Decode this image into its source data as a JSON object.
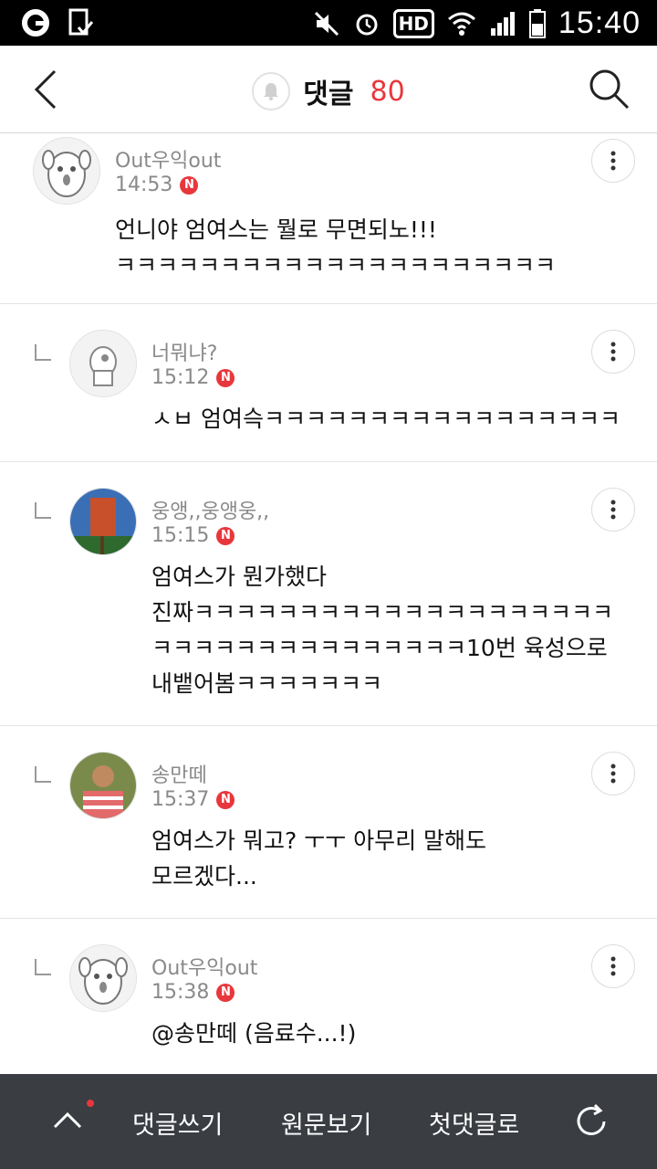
{
  "status_bar": {
    "time": "15:40",
    "hd_label": "HD"
  },
  "header": {
    "title": "댓글",
    "count": "80"
  },
  "comments": [
    {
      "nickname": "Out우익out",
      "time": "14:53",
      "badge": "N",
      "text": "언니야 엄여스는 뭘로 무면되노!!!\nㅋㅋㅋㅋㅋㅋㅋㅋㅋㅋㅋㅋㅋㅋㅋㅋㅋㅋㅋㅋㅋ",
      "reply": false,
      "avatar": "dog"
    },
    {
      "nickname": "너뭐냐?",
      "time": "15:12",
      "badge": "N",
      "text": "ㅅㅂ 엄여슥ㅋㅋㅋㅋㅋㅋㅋㅋㅋㅋㅋㅋㅋㅋㅋㅋㅋ",
      "reply": true,
      "avatar": "ghost"
    },
    {
      "nickname": "웅앵,,웅앵웅,,",
      "time": "15:15",
      "badge": "N",
      "text": "엄여스가 뭔가했다\n진짜ㅋㅋㅋㅋㅋㅋㅋㅋㅋㅋㅋㅋㅋㅋㅋㅋㅋㅋㅋㅋ\nㅋㅋㅋㅋㅋㅋㅋㅋㅋㅋㅋㅋㅋㅋㅋ10번 육성으로\n내뱉어봄ㅋㅋㅋㅋㅋㅋㅋ",
      "reply": true,
      "avatar": "photo-sign"
    },
    {
      "nickname": "송만떼",
      "time": "15:37",
      "badge": "N",
      "text": "엄여스가 뭐고? ㅜㅜ 아무리 말해도\n모르겠다...",
      "reply": true,
      "avatar": "photo-person"
    },
    {
      "nickname": "Out우익out",
      "time": "15:38",
      "badge": "N",
      "text": "@송만떼 (음료수...!)",
      "reply": true,
      "avatar": "dog"
    }
  ],
  "bottom_bar": {
    "write": "댓글쓰기",
    "original": "원문보기",
    "first": "첫댓글로"
  },
  "colors": {
    "accent": "#e8373c",
    "bottom_bg": "#3a3d42"
  }
}
